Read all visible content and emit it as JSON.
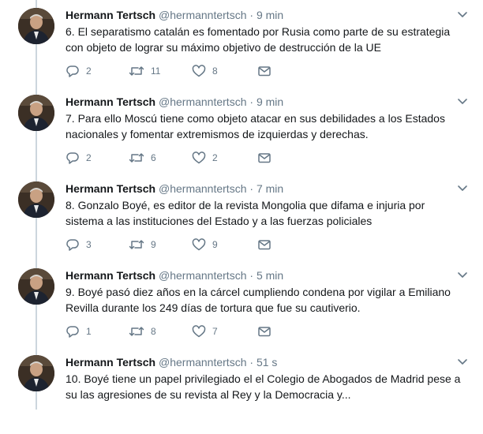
{
  "tweets": [
    {
      "name": "Hermann Tertsch",
      "handle": "@hermanntertsch",
      "separator": "·",
      "time": "9 min",
      "text": "6. El separatismo catalán es fomentado por Rusia como parte de su estrategia con objeto de lograr su máximo objetivo de destrucción de la UE",
      "replies": "2",
      "retweets": "11",
      "likes": "8"
    },
    {
      "name": "Hermann Tertsch",
      "handle": "@hermanntertsch",
      "separator": "·",
      "time": "9 min",
      "text": "7. Para ello Moscú tiene como objeto atacar en sus debilidades a los Estados nacionales y fomentar extremismos de izquierdas y derechas.",
      "replies": "2",
      "retweets": "6",
      "likes": "2"
    },
    {
      "name": "Hermann Tertsch",
      "handle": "@hermanntertsch",
      "separator": "·",
      "time": "7 min",
      "text": "8. Gonzalo Boyé, es editor de la revista Mongolia que difama e injuria por sistema a las instituciones del Estado y a las fuerzas policiales",
      "replies": "3",
      "retweets": "9",
      "likes": "9"
    },
    {
      "name": "Hermann Tertsch",
      "handle": "@hermanntertsch",
      "separator": "·",
      "time": "5 min",
      "text": "9. Boyé pasó diez años en la cárcel cumpliendo condena por vigilar a Emiliano Revilla durante los 249 días de tortura que fue su cautiverio.",
      "replies": "1",
      "retweets": "8",
      "likes": "7"
    },
    {
      "name": "Hermann Tertsch",
      "handle": "@hermanntertsch",
      "separator": "·",
      "time": "51 s",
      "text": "10. Boyé tiene un papel privilegiado el el Colegio de Abogados de Madrid pese a su las agresiones de su revista al Rey y la Democracia y...",
      "replies": "",
      "retweets": "",
      "likes": ""
    }
  ],
  "icons": {
    "reply": "reply-icon",
    "retweet": "retweet-icon",
    "like": "heart-icon",
    "message": "envelope-icon",
    "caret": "chevron-down-icon"
  },
  "colors": {
    "text": "#14171a",
    "secondary": "#657786",
    "thread_line": "#ccd6dd"
  }
}
